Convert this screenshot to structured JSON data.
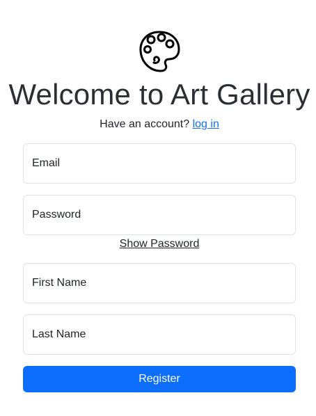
{
  "header": {
    "logo_icon": "palette-icon",
    "title": "Welcome to Art Gallery",
    "subtitle_prefix": "Have an account?",
    "login_link": "log in"
  },
  "form": {
    "email_placeholder": "Email",
    "password_placeholder": "Password",
    "show_password_label": "Show Password",
    "first_name_placeholder": "First Name",
    "last_name_placeholder": "Last Name",
    "register_label": "Register"
  },
  "colors": {
    "primary": "#0d6efd",
    "text": "#212529",
    "border": "#dee2e6"
  }
}
